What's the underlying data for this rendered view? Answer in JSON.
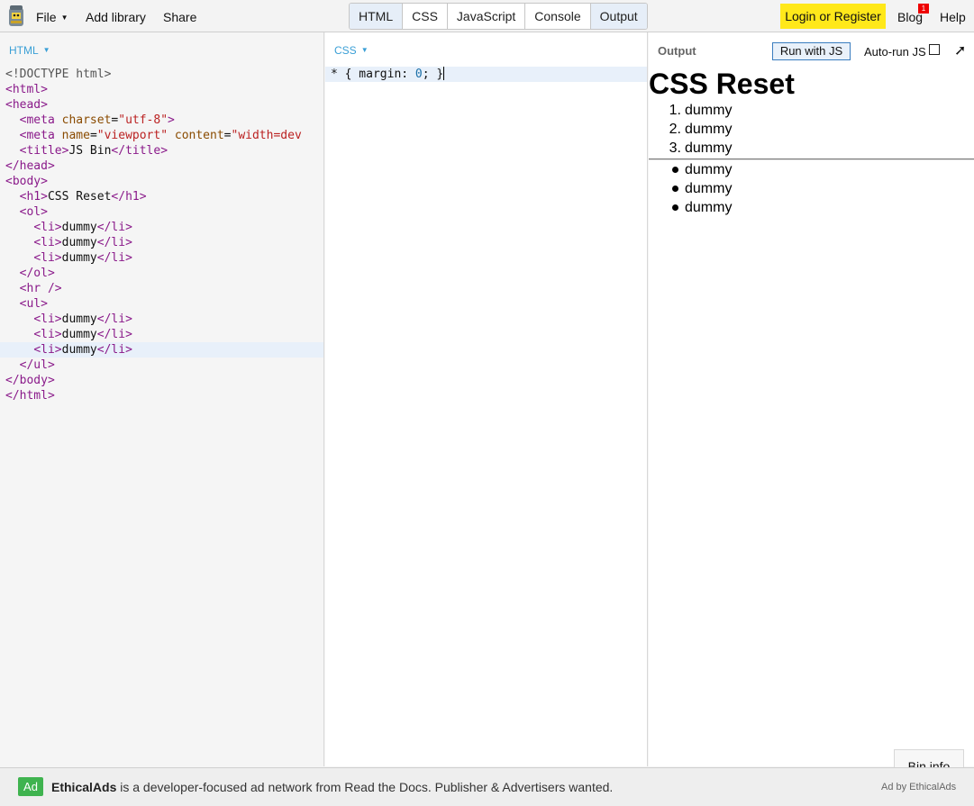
{
  "menu": {
    "file": "File",
    "add_library": "Add library",
    "share": "Share",
    "login": "Login or Register",
    "blog": "Blog",
    "blog_badge": "1",
    "help": "Help"
  },
  "tabs": [
    "HTML",
    "CSS",
    "JavaScript",
    "Console",
    "Output"
  ],
  "html_panel": {
    "label": "HTML",
    "lines": [
      "<!DOCTYPE html>",
      "<html>",
      "<head>",
      "  <meta charset=\"utf-8\">",
      "  <meta name=\"viewport\" content=\"width=dev",
      "  <title>JS Bin</title>",
      "</head>",
      "<body>",
      "  <h1>CSS Reset</h1>",
      "  <ol>",
      "    <li>dummy</li>",
      "    <li>dummy</li>",
      "    <li>dummy</li>",
      "  </ol>",
      "  <hr />",
      "  <ul>",
      "    <li>dummy</li>",
      "    <li>dummy</li>",
      "    <li>dummy</li>",
      "  </ul>",
      "</body>",
      "</html>"
    ]
  },
  "css_panel": {
    "label": "CSS",
    "line": "* { margin: 0; }"
  },
  "output_panel": {
    "label": "Output",
    "run_button": "Run with JS",
    "autorun_label": "Auto-run JS",
    "heading": "CSS Reset",
    "ordered_items": [
      "dummy",
      "dummy",
      "dummy"
    ],
    "unordered_items": [
      "dummy",
      "dummy",
      "dummy"
    ],
    "bin_info": "Bin info"
  },
  "ad": {
    "badge": "Ad",
    "brand": "EthicalAds",
    "text": " is a developer-focused ad network from Read the Docs. Publisher & Advertisers wanted.",
    "by": "Ad by EthicalAds"
  },
  "colors": {
    "accent": "#3a9fd6",
    "login_bg": "#ffe81a",
    "ad_badge": "#3fb34f"
  }
}
